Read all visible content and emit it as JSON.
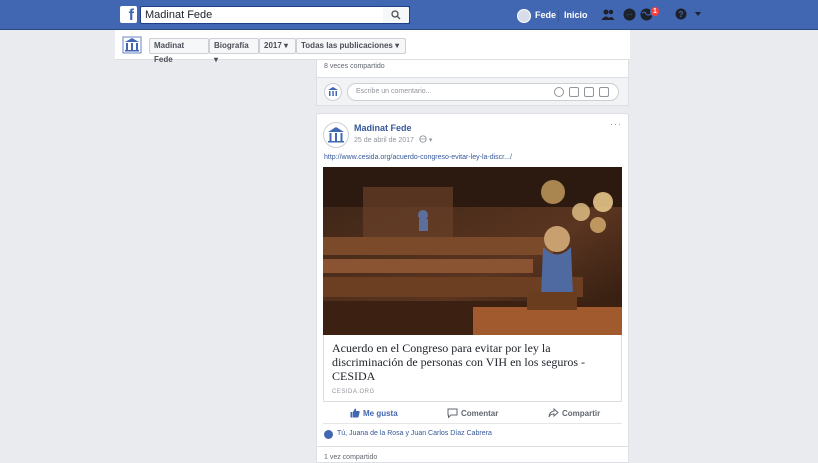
{
  "topbar": {
    "search_value": "Madinat Fede",
    "profile_name": "Fede",
    "home_label": "Inicio",
    "notifications_count": "1"
  },
  "timeline_bar": {
    "profile_name": "Madinat Fede",
    "section": "Biografía",
    "year": "2017",
    "filter": "Todas las publicaciones"
  },
  "previous_post": {
    "shares": "8 veces compartido",
    "comment_placeholder": "Escribe un comentario..."
  },
  "post": {
    "author": "Madinat Fede",
    "date": "25 de abril de 2017",
    "privacy_icon": "globe-icon",
    "url": "http://www.cesida.org/acuerdo-congreso-evitar-ley-la-discr.../",
    "link_title": "Acuerdo en el Congreso para evitar por ley la discriminación de personas con VIH en los seguros - CESIDA",
    "link_domain": "CESIDA.ORG",
    "actions": {
      "like": "Me gusta",
      "comment": "Comentar",
      "share": "Compartir"
    },
    "reactions_text": "Tú, Juana de la Rosa y Juan Carlos Díaz Cabrera",
    "shares": "1 vez compartido"
  },
  "colors": {
    "brand": "#4267b2",
    "link": "#365899",
    "background": "#e9ebee"
  }
}
